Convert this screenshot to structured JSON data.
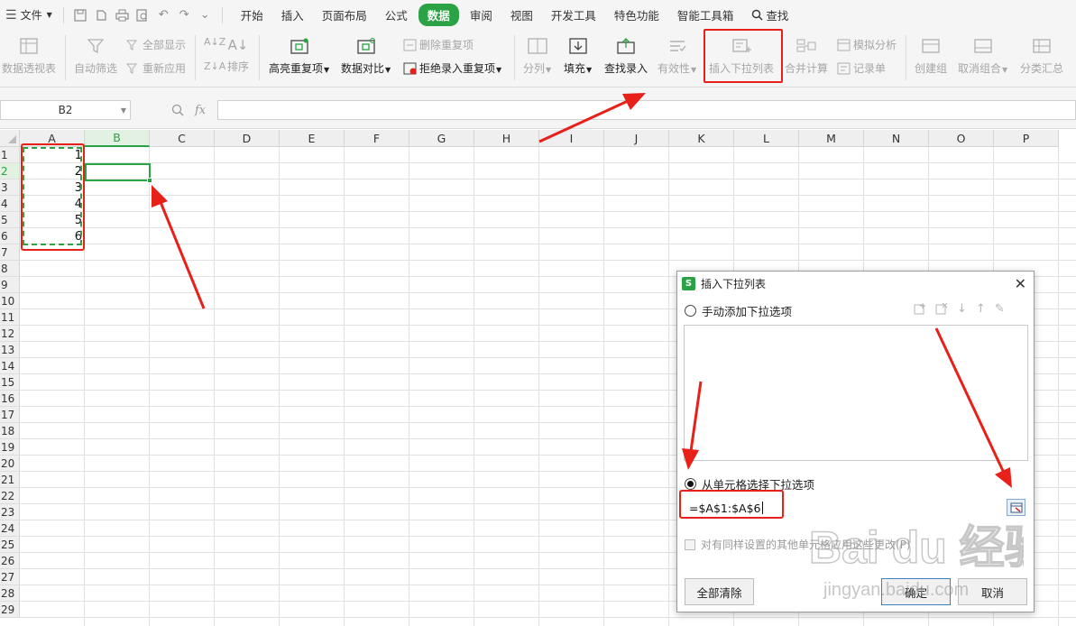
{
  "menubar": {
    "file_label": "文件",
    "tabs": [
      "开始",
      "插入",
      "页面布局",
      "公式",
      "数据",
      "审阅",
      "视图",
      "开发工具",
      "特色功能",
      "智能工具箱"
    ],
    "active_tab": "数据",
    "search_label": "查找"
  },
  "ribbon": {
    "pivot": "数据透视表",
    "autofilter": "自动筛选",
    "show_all": "全部显示",
    "reapply": "重新应用",
    "sort": "排序",
    "highlight_dup": "高亮重复项",
    "compare": "数据对比",
    "delete_dup": "删除重复项",
    "reject_dup": "拒绝录入重复项",
    "split": "分列",
    "fill": "填充",
    "lookup_entry": "查找录入",
    "validity": "有效性",
    "insert_dropdown": "插入下拉列表",
    "consolidate": "合并计算",
    "simulate": "模拟分析",
    "record": "记录单",
    "create_group": "创建组",
    "ungroup": "取消组合",
    "subtotal": "分类汇总"
  },
  "formula_bar": {
    "cell_ref": "B2",
    "fx_label": "fx",
    "formula": ""
  },
  "sheet": {
    "columns": [
      "A",
      "B",
      "C",
      "D",
      "E",
      "F",
      "G",
      "H",
      "I",
      "J",
      "K",
      "L",
      "M",
      "N",
      "O",
      "P"
    ],
    "selected_column": "B",
    "rows": [
      "1",
      "2",
      "3",
      "4",
      "5",
      "6",
      "7",
      "8",
      "9",
      "10",
      "11",
      "12",
      "13",
      "14",
      "15",
      "16",
      "17",
      "18",
      "19",
      "20",
      "21",
      "22",
      "23",
      "24",
      "25",
      "26",
      "27",
      "28",
      "29"
    ],
    "selected_row": "2",
    "column_a_values": [
      "1",
      "2",
      "3",
      "4",
      "5",
      "6"
    ]
  },
  "dialog": {
    "title": "插入下拉列表",
    "option_manual": "手动添加下拉选项",
    "option_from_cells": "从单元格选择下拉选项",
    "selected_option": "from_cells",
    "range_value": "=$A$1:$A$6",
    "apply_same_label": "对有同样设置的其他单元格应用这些更改(P)",
    "clear_all_button": "全部清除",
    "ok_button": "确定",
    "cancel_button": "取消"
  },
  "watermark": {
    "brand": "Bai du 经验",
    "url": "jingyan.baidu.com"
  },
  "colors": {
    "accent_green": "#2ba245",
    "annotation_red": "#e8201a"
  }
}
